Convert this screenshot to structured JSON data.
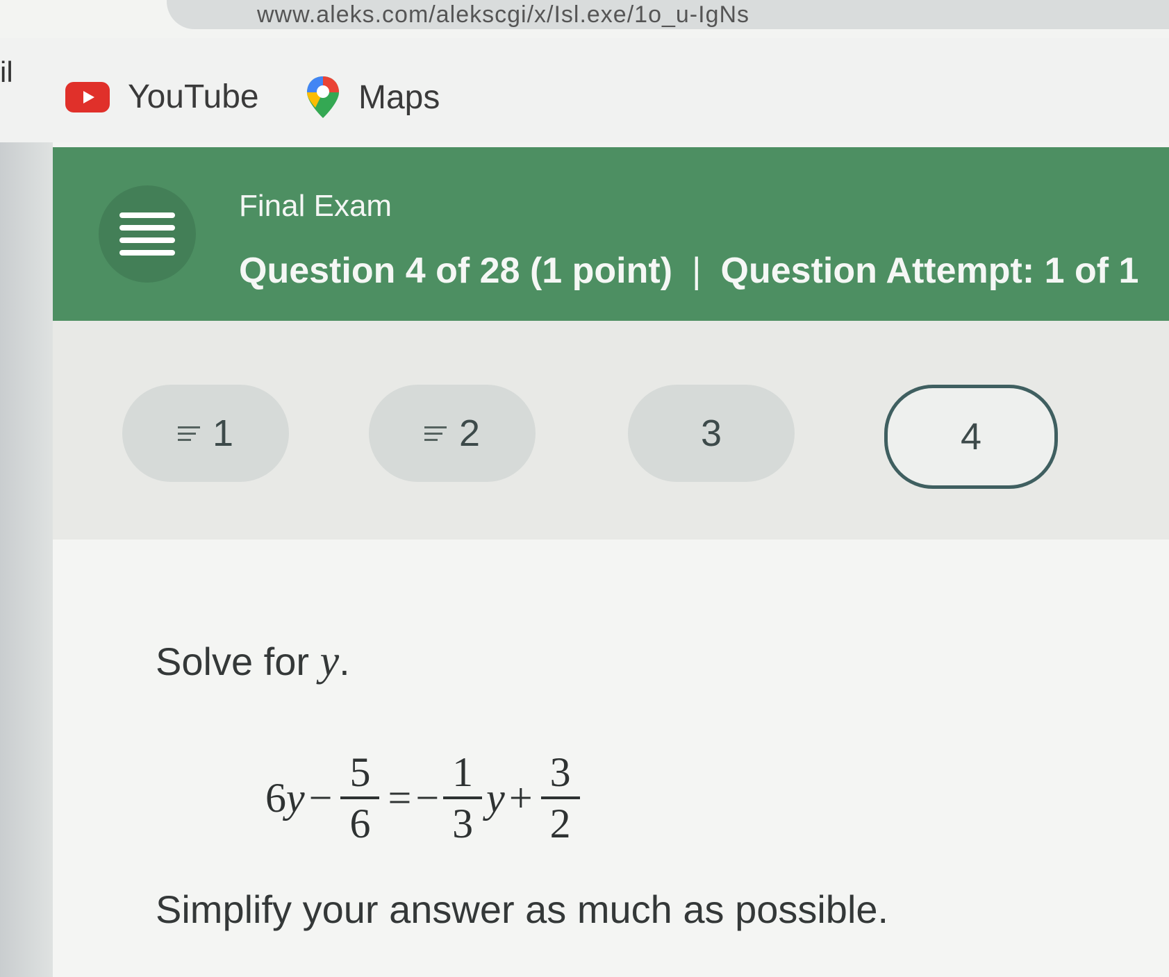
{
  "browser": {
    "url_fragment": "www.aleks.com/alekscgi/x/Isl.exe/1o_u-IgNs",
    "bookmarks": {
      "cut_label": "il",
      "youtube": "YouTube",
      "maps": "Maps"
    }
  },
  "header": {
    "title": "Final Exam",
    "question_info": "Question 4 of 28 (1 point)",
    "separator": "|",
    "attempt_info": "Question Attempt: 1 of 1"
  },
  "question_nav": [
    {
      "label": "1",
      "icon": "list-icon",
      "active": false
    },
    {
      "label": "2",
      "icon": "list-icon",
      "active": false
    },
    {
      "label": "3",
      "icon": "",
      "active": false
    },
    {
      "label": "4",
      "icon": "",
      "active": true
    }
  ],
  "problem": {
    "prompt_text": "Solve for",
    "prompt_var": "y",
    "prompt_end": ".",
    "equation": {
      "lhs_coef": "6",
      "var": "y",
      "minus": "−",
      "frac1_num": "5",
      "frac1_den": "6",
      "equals": "=",
      "neg": "−",
      "frac2_num": "1",
      "frac2_den": "3",
      "plus": "+",
      "frac3_num": "3",
      "frac3_den": "2"
    },
    "instruction": "Simplify your answer as much as possible."
  },
  "colors": {
    "header_green": "#4d8f62",
    "active_border": "#3f5f60",
    "youtube_red": "#e0302a"
  }
}
